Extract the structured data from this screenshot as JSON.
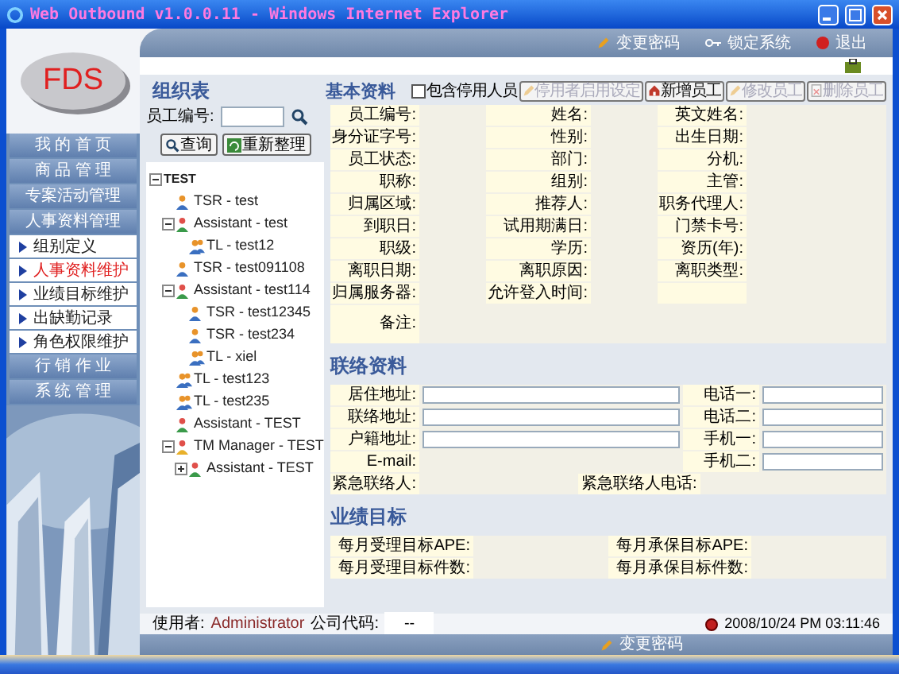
{
  "window": {
    "title": "Web Outbound v1.0.0.11 - Windows Internet Explorer"
  },
  "logo": {
    "text": "FDS"
  },
  "sidebar": {
    "items": [
      {
        "label": "我 的 首 页",
        "kind": "group",
        "selected": false
      },
      {
        "label": "商 品 管 理",
        "kind": "group",
        "selected": false
      },
      {
        "label": "专案活动管理",
        "kind": "group",
        "selected": false
      },
      {
        "label": "人事资料管理",
        "kind": "group",
        "selected": false
      },
      {
        "label": "组别定义",
        "kind": "sub",
        "selected": false
      },
      {
        "label": "人事资料维护",
        "kind": "sub",
        "selected": true
      },
      {
        "label": "业绩目标维护",
        "kind": "sub",
        "selected": false
      },
      {
        "label": "出缺勤记录",
        "kind": "sub",
        "selected": false
      },
      {
        "label": "角色权限维护",
        "kind": "sub",
        "selected": false
      },
      {
        "label": "行 销 作 业",
        "kind": "group",
        "selected": false
      },
      {
        "label": "系 统 管 理",
        "kind": "group",
        "selected": false
      }
    ]
  },
  "top_links": [
    {
      "label": "变更密码",
      "kind": "password"
    },
    {
      "label": "锁定系统",
      "kind": "lock"
    },
    {
      "label": "退出",
      "kind": "exit"
    }
  ],
  "org": {
    "title": "组织表",
    "search_label": "员工编号:",
    "buttons": [
      {
        "label": "查询",
        "kind": "search"
      },
      {
        "label": "重新整理",
        "kind": "refresh"
      }
    ],
    "tree": [
      {
        "label": "TEST",
        "expanded": true,
        "children": [
          {
            "label": "TSR - test",
            "kind": "tsr"
          },
          {
            "label": "Assistant - test",
            "kind": "assistant",
            "expanded": true,
            "children": [
              {
                "label": "TL - test12",
                "kind": "tl"
              }
            ]
          },
          {
            "label": "TSR - test091108",
            "kind": "tsr"
          },
          {
            "label": "Assistant - test114",
            "kind": "assistant",
            "expanded": true,
            "children": [
              {
                "label": "TSR - test12345",
                "kind": "tsr"
              },
              {
                "label": "TSR - test234",
                "kind": "tsr"
              },
              {
                "label": "TL - xiel",
                "kind": "tl"
              }
            ]
          },
          {
            "label": "TL - test123",
            "kind": "tl"
          },
          {
            "label": "TL - test235",
            "kind": "tl"
          },
          {
            "label": "Assistant - TEST",
            "kind": "assistant"
          },
          {
            "label": "TM Manager - TEST",
            "kind": "manager",
            "expanded": true,
            "children": [
              {
                "label": "Assistant - TEST",
                "kind": "assistant",
                "expanded": false
              }
            ]
          }
        ]
      }
    ]
  },
  "basic_info": {
    "title": "基本资料",
    "include_disabled": {
      "label": "包含停用人员",
      "checked": false
    },
    "actions": [
      {
        "label": "停用者启用设定",
        "kind": "edit",
        "disabled": true
      },
      {
        "label": "新增员工",
        "kind": "add",
        "disabled": false
      },
      {
        "label": "修改员工",
        "kind": "edit",
        "disabled": true
      },
      {
        "label": "删除员工",
        "kind": "delete",
        "disabled": true
      }
    ],
    "fields": [
      "员工编号:",
      "姓名:",
      "英文姓名:",
      "身分证字号:",
      "性别:",
      "出生日期:",
      "员工状态:",
      "部门:",
      "分机:",
      "职称:",
      "组别:",
      "主管:",
      "归属区域:",
      "推荐人:",
      "职务代理人:",
      "到职日:",
      "试用期满日:",
      "门禁卡号:",
      "职级:",
      "学历:",
      "资历(年):",
      "离职日期:",
      "离职原因:",
      "离职类型:",
      "归属服务器:",
      "允许登入时间:"
    ],
    "remark_label": "备注:"
  },
  "contact": {
    "title": "联络资料",
    "rows": [
      {
        "label": "居住地址:",
        "kind": "input",
        "label_2": "电话一:"
      },
      {
        "label": "联络地址:",
        "kind": "input",
        "label_2": "电话二:"
      },
      {
        "label": "户籍地址:",
        "kind": "input",
        "label_2": "手机一:"
      },
      {
        "label": "E-mail:",
        "kind": "text",
        "label_2": "手机二:"
      },
      {
        "label": "紧急联络人:",
        "kind": "plain",
        "label_2": "紧急联络人电话:"
      }
    ]
  },
  "targets": {
    "title": "业绩目标",
    "rows": [
      {
        "label": "每月受理目标APE:",
        "label_2": "每月承保目标APE:"
      },
      {
        "label": "每月受理目标件数:",
        "label_2": "每月承保目标件数:"
      }
    ]
  },
  "status_bar": {
    "user_label": "使用者:",
    "user": "Administrator",
    "company_label": "公司代码:",
    "company": "--",
    "time": "2008/10/24 PM 03:11:46"
  },
  "bottom_links": [
    {
      "label": "变更密码"
    }
  ]
}
